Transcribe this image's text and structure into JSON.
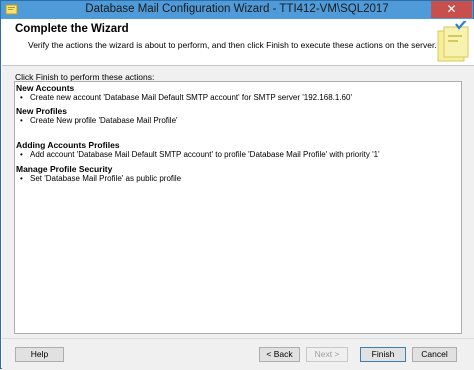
{
  "window": {
    "title": "Database Mail Configuration Wizard - TTI412-VM\\SQL2017",
    "close_glyph": "✕"
  },
  "header": {
    "title": "Complete the Wizard",
    "subtitle": "Verify the actions the wizard is about to perform, and then click Finish to execute these actions on the server."
  },
  "content": {
    "label": "Click Finish to perform these actions:",
    "sections": [
      {
        "title": "New Accounts",
        "items": [
          "Create new account 'Database Mail Default SMTP account' for SMTP server '192.168.1.60'"
        ]
      },
      {
        "title": "New Profiles",
        "items": [
          "Create New profile 'Database Mail Profile'"
        ]
      },
      {
        "title": "Adding Accounts Profiles",
        "items": [
          "Add account 'Database Mail Default SMTP account' to profile 'Database Mail Profile' with priority '1'"
        ]
      },
      {
        "title": "Manage Profile Security",
        "items": [
          "Set 'Database Mail Profile' as public profile"
        ]
      }
    ]
  },
  "footer": {
    "help_label": "Help",
    "back_label": "< Back",
    "next_label": "Next >",
    "finish_label": "Finish",
    "cancel_label": "Cancel"
  },
  "colors": {
    "titlebar": "#4f9bd9",
    "close_button": "#c7504c"
  },
  "icons": {
    "app": "wizard-app-icon",
    "header": "wizard-check-graphic"
  }
}
